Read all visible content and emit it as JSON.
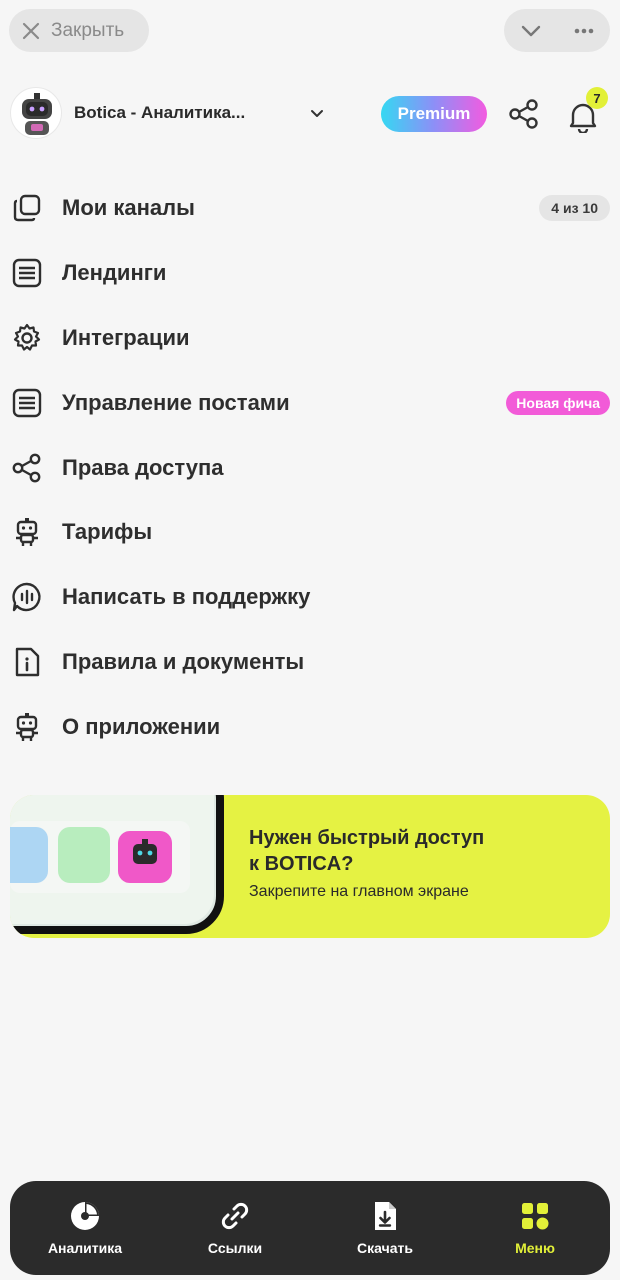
{
  "topbar": {
    "close_label": "Закрыть"
  },
  "header": {
    "channel_name": "Botica - Аналитика...",
    "premium_label": "Premium",
    "notifications_count": "7"
  },
  "menu": {
    "items": [
      {
        "label": "Мои каналы",
        "icon": "copy-icon",
        "badge": "4 из 10"
      },
      {
        "label": "Лендинги",
        "icon": "document-lines-icon"
      },
      {
        "label": "Интеграции",
        "icon": "gear-icon"
      },
      {
        "label": "Управление постами",
        "icon": "document-lines-icon",
        "badge": "Новая фича"
      },
      {
        "label": "Права доступа",
        "icon": "share-icon"
      },
      {
        "label": "Тарифы",
        "icon": "robot-icon"
      },
      {
        "label": "Написать в поддержку",
        "icon": "support-chat-icon"
      },
      {
        "label": "Правила и документы",
        "icon": "info-document-icon"
      },
      {
        "label": "О приложении",
        "icon": "robot-icon"
      }
    ]
  },
  "banner": {
    "title_line1": "Нужен быстрый доступ",
    "title_line2": "к BOTICA?",
    "subtitle": "Закрепите на главном экране"
  },
  "bottom_nav": {
    "items": [
      {
        "label": "Аналитика",
        "icon": "pie-chart-icon",
        "active": false
      },
      {
        "label": "Ссылки",
        "icon": "link-icon",
        "active": false
      },
      {
        "label": "Скачать",
        "icon": "download-file-icon",
        "active": false
      },
      {
        "label": "Меню",
        "icon": "grid-menu-icon",
        "active": true
      }
    ]
  },
  "colors": {
    "accent": "#e2f038",
    "banner": "#e5f243",
    "new_badge": "#f25bd8",
    "nav_bg": "#2b2b2b"
  }
}
